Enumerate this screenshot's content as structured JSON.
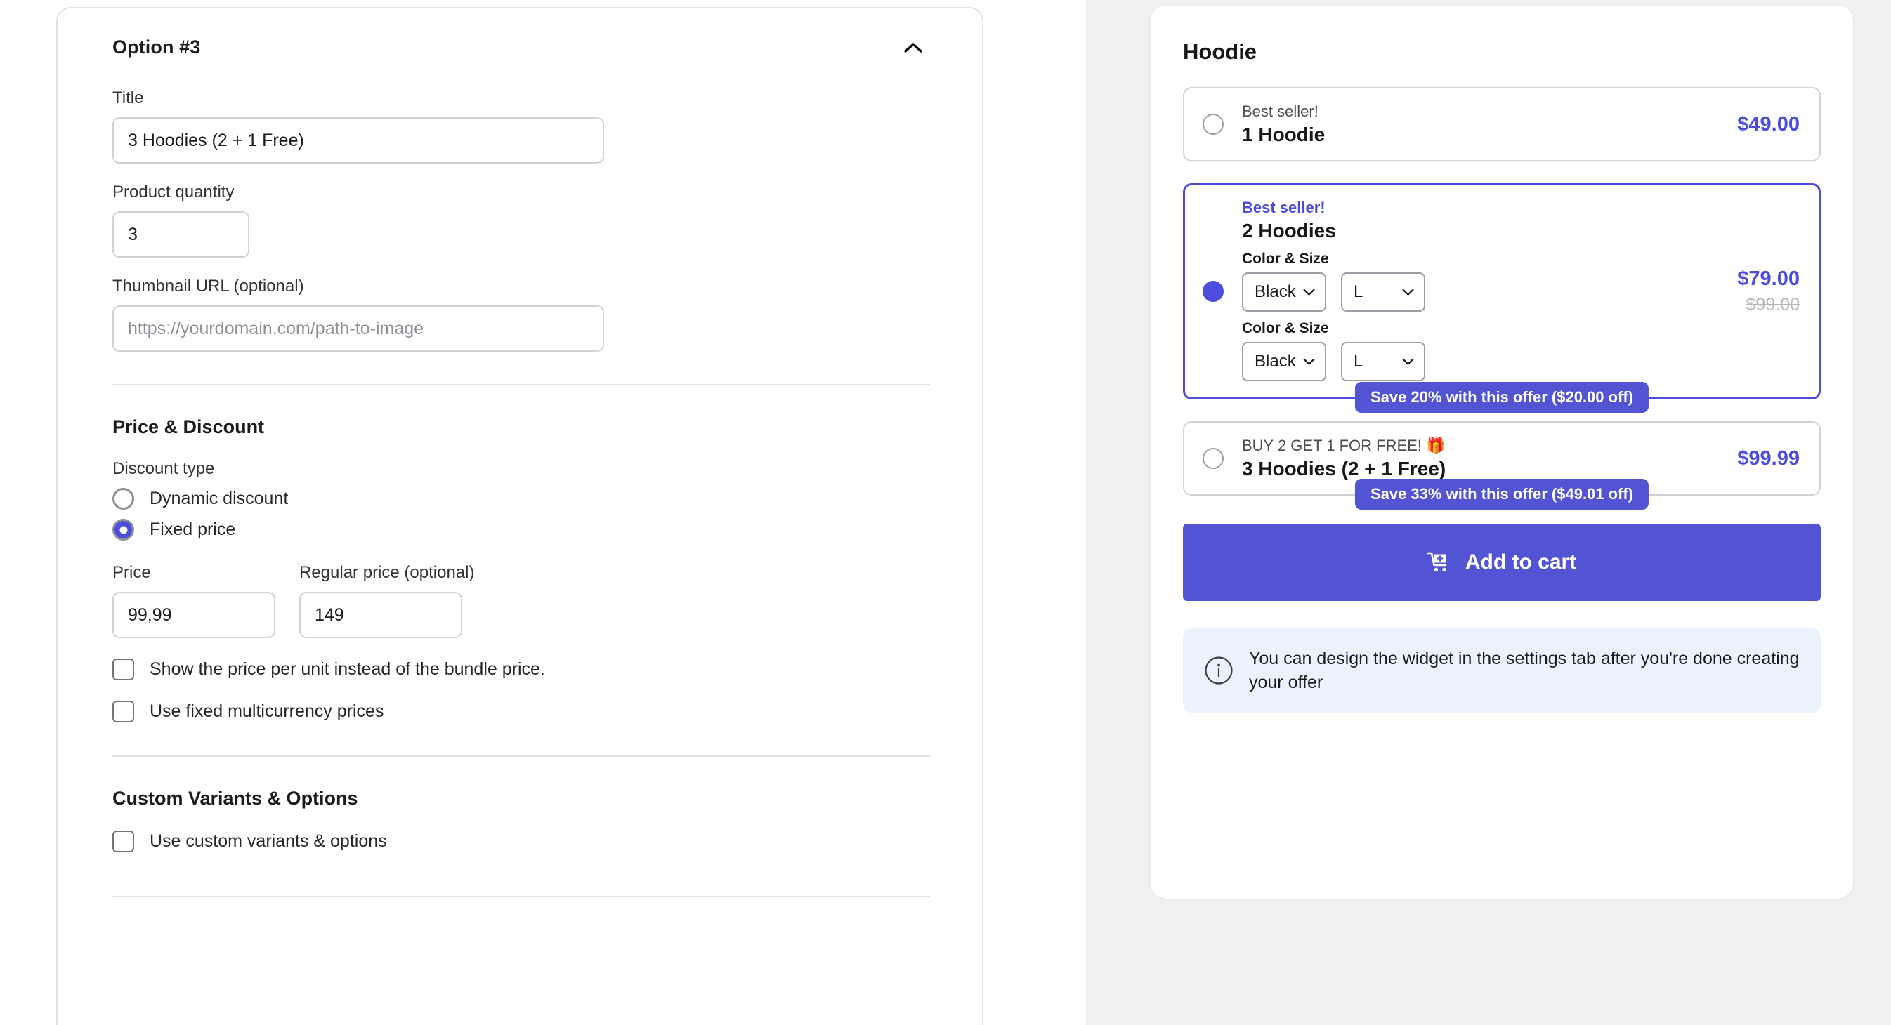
{
  "editor": {
    "option_title": "Option #3",
    "collapse_icon": "chevron-up-icon",
    "title_label": "Title",
    "title_value": "3 Hoodies (2 + 1 Free)",
    "quantity_label": "Product quantity",
    "quantity_value": "3",
    "thumbnail_label": "Thumbnail URL (optional)",
    "thumbnail_placeholder": "https://yourdomain.com/path-to-image",
    "thumbnail_value": "",
    "price_section_title": "Price & Discount",
    "discount_type_label": "Discount type",
    "discount_options": [
      {
        "label": "Dynamic discount",
        "selected": false
      },
      {
        "label": "Fixed price",
        "selected": true
      }
    ],
    "price_label": "Price",
    "price_value": "99,99",
    "regular_price_label": "Regular price (optional)",
    "regular_price_value": "149",
    "checkboxes": [
      {
        "label": "Show the price per unit instead of the bundle price.",
        "checked": false
      },
      {
        "label": "Use fixed multicurrency prices",
        "checked": false
      }
    ],
    "variants_section_title": "Custom Variants & Options",
    "variants_checkbox": {
      "label": "Use custom variants & options",
      "checked": false
    }
  },
  "preview": {
    "product_name": "Hoodie",
    "offers": [
      {
        "tagline": "Best seller!",
        "name": "1 Hoodie",
        "price": "$49.00",
        "compare_price": "",
        "selected": false,
        "save_badge": "",
        "variants": []
      },
      {
        "tagline": "Best seller!",
        "name": "2 Hoodies",
        "price": "$79.00",
        "compare_price": "$99.00",
        "selected": true,
        "save_badge": "Save 20% with this offer ($20.00 off)",
        "variants": [
          {
            "label": "Color & Size",
            "color": "Black",
            "size": "L"
          },
          {
            "label": "Color & Size",
            "color": "Black",
            "size": "L"
          }
        ]
      },
      {
        "tagline": "BUY 2 GET 1 FOR FREE! 🎁",
        "name": "3 Hoodies (2 + 1 Free)",
        "price": "$99.99",
        "compare_price": "",
        "selected": false,
        "save_badge": "Save 33% with this offer ($49.01 off)",
        "variants": []
      }
    ],
    "add_to_cart_label": "Add to cart",
    "cart_icon": "cart-plus-icon",
    "info_icon": "info-circle-icon",
    "info_text": "You can design the widget in the settings tab after you're done creating your offer"
  },
  "colors": {
    "accent": "#4c4ddc",
    "badge": "#5254d4",
    "info_bg": "#eaf2fd",
    "page_bg": "#f0f0f0",
    "border": "#cfd3d8"
  }
}
